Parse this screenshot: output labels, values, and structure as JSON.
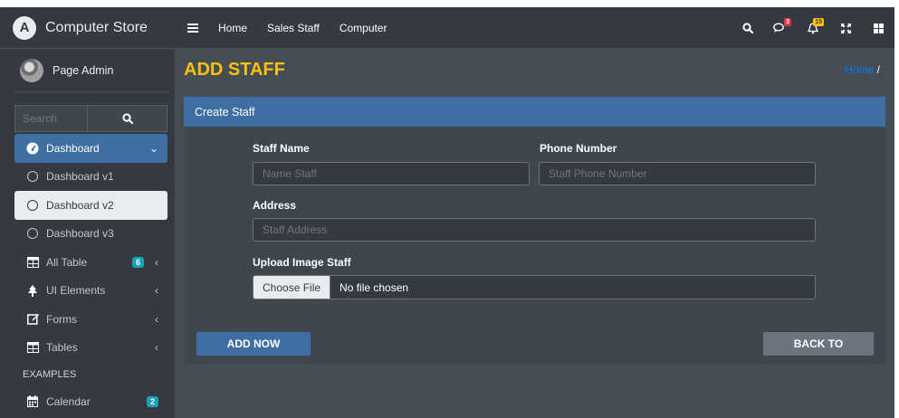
{
  "brand": {
    "logo_letter": "A",
    "name": "Computer Store"
  },
  "user": {
    "name": "Page Admin"
  },
  "search": {
    "placeholder": "Search"
  },
  "sidebar": {
    "items": [
      {
        "label": "Dashboard",
        "icon": "tachometer-icon",
        "state": "active"
      },
      {
        "label": "Dashboard v1",
        "icon": "circle-icon"
      },
      {
        "label": "Dashboard v2",
        "icon": "circle-icon",
        "state": "selected"
      },
      {
        "label": "Dashboard v3",
        "icon": "circle-icon"
      },
      {
        "label": "All Table",
        "icon": "table-icon",
        "badge": "6"
      },
      {
        "label": "UI Elements",
        "icon": "tree-icon"
      },
      {
        "label": "Forms",
        "icon": "edit-icon"
      },
      {
        "label": "Tables",
        "icon": "table-icon"
      }
    ],
    "header": "EXAMPLES",
    "examples": [
      {
        "label": "Calendar",
        "icon": "calendar-icon",
        "badge": "2"
      }
    ]
  },
  "topbar": {
    "links": [
      "Home",
      "Sales Staff",
      "Computer"
    ],
    "messages_badge": "3",
    "notifications_badge": "15"
  },
  "page": {
    "title": "ADD STAFF",
    "breadcrumb_home": "Home",
    "breadcrumb_sep": "/"
  },
  "form": {
    "card_title": "Create Staff",
    "staff_name_label": "Staff Name",
    "staff_name_placeholder": "Name Staff",
    "phone_label": "Phone Number",
    "phone_placeholder": "Staff Phone Number",
    "address_label": "Address",
    "address_placeholder": "Staff Address",
    "upload_label": "Upload Image Staff",
    "file_button": "Choose File",
    "file_status": "No file chosen",
    "add_button": "ADD NOW",
    "back_button": "BACK TO"
  },
  "colors": {
    "sidebar_bg": "#343a40",
    "content_bg": "#454d55",
    "primary": "#3f6ea5",
    "title_accent": "#ffc107",
    "badge_info": "#17a2b8",
    "badge_danger": "#dc3545",
    "badge_warning": "#ffc107"
  }
}
